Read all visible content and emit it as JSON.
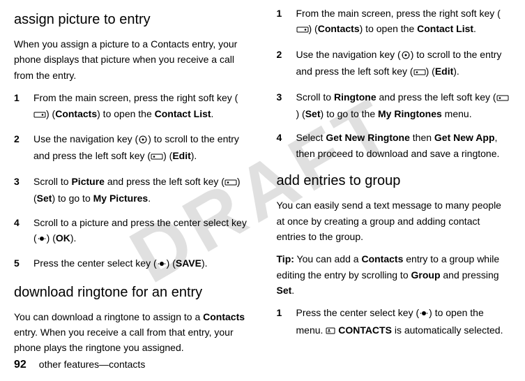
{
  "watermark": "DRAFT",
  "left": {
    "h1": "assign picture to entry",
    "p1a": "When you assign a picture to a Contacts entry, your phone displays that picture when you receive a call from the entry.",
    "s1": {
      "n": "1",
      "a": "From the main screen, press the right soft key (",
      "b": ") (",
      "contacts": "Contacts",
      "c": ") to open the ",
      "list": "Contact List",
      "d": "."
    },
    "s2": {
      "n": "2",
      "a": "Use the navigation key (",
      "b": ") to scroll to the entry and press the left soft key (",
      "c": ") (",
      "edit": "Edit",
      "d": ")."
    },
    "s3": {
      "n": "3",
      "a": "Scroll to ",
      "pic": "Picture",
      "b": " and press the left soft key (",
      "c": ") (",
      "set": "Set",
      "d": ") to go to ",
      "mypic": "My Pictures",
      "e": "."
    },
    "s4": {
      "n": "4",
      "a": "Scroll to a picture and press the center select key (",
      "b": ") (",
      "ok": "OK",
      "c": ")."
    },
    "s5": {
      "n": "5",
      "a": "Press the center select key (",
      "b": ") (",
      "save": "SAVE",
      "c": ")."
    },
    "h2": "download ringtone for an entry",
    "p2a": "You can download a ringtone to assign to a ",
    "p2b": "Contacts",
    "p2c": " entry. When you receive a call from that entry, your phone plays the ringtone you assigned."
  },
  "right": {
    "s1": {
      "n": "1",
      "a": "From the main screen, press the right soft key (",
      "b": ") (",
      "contacts": "Contacts",
      "c": ") to open the ",
      "list": "Contact List",
      "d": "."
    },
    "s2": {
      "n": "2",
      "a": "Use the navigation key (",
      "b": ") to scroll to the entry and press the left soft key (",
      "c": ") (",
      "edit": "Edit",
      "d": ")."
    },
    "s3": {
      "n": "3",
      "a": "Scroll to ",
      "ring": "Ringtone",
      "b": " and press the left soft key (",
      "c": ") (",
      "set": "Set",
      "d": ") to go to the ",
      "myring": "My Ringtones",
      "e": " menu."
    },
    "s4": {
      "n": "4",
      "a": "Select ",
      "gnr": "Get New Ringtone",
      "b": " then ",
      "gna": "Get New App",
      "c": ", then proceed to download and save a ringtone."
    },
    "h1": "add entries to group",
    "p1": "You can easily send a text message to many people at once by creating a group and adding contact entries to the group.",
    "tip_a": "Tip:",
    "tip_b": " You can add a ",
    "tip_c": "Contacts",
    "tip_d": " entry to a group while editing the entry by scrolling to ",
    "tip_e": "Group",
    "tip_f": " and pressing ",
    "tip_g": "Set",
    "tip_h": ".",
    "gs1": {
      "n": "1",
      "a": "Press the center select key (",
      "b": ") to open the menu. ",
      "c": "CONTACTS",
      "d": " is automatically selected."
    }
  },
  "footer": {
    "page": "92",
    "label": "other features—contacts"
  }
}
